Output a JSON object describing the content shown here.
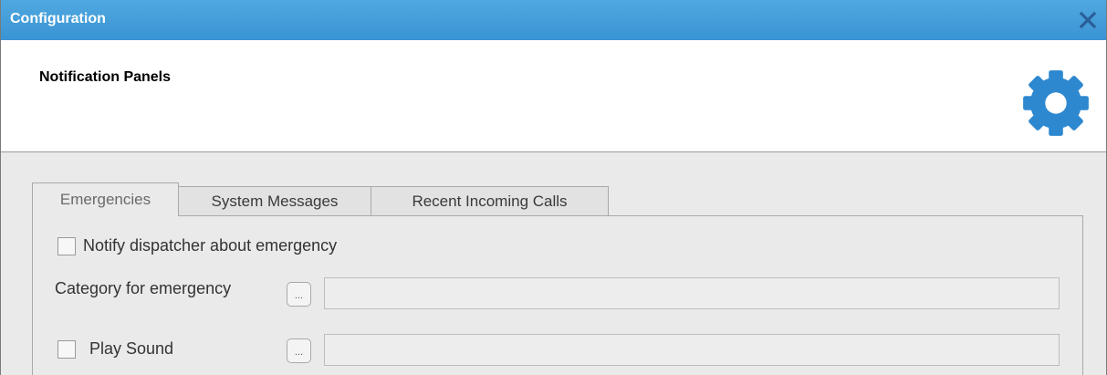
{
  "window": {
    "title": "Configuration",
    "close_icon": "close-icon",
    "accent_color": "#3b94d3"
  },
  "header": {
    "title": "Notification Panels",
    "icon": "gear-icon",
    "icon_color": "#2e88cf"
  },
  "tabs": [
    {
      "label": "Emergencies",
      "active": true
    },
    {
      "label": "System Messages",
      "active": false
    },
    {
      "label": "Recent Incoming Calls",
      "active": false
    }
  ],
  "emergencies": {
    "notify_checkbox": {
      "label": "Notify dispatcher about emergency",
      "checked": false
    },
    "category": {
      "label": "Category for emergency",
      "browse_label": "...",
      "value": ""
    },
    "play_sound": {
      "label": "Play Sound",
      "checked": false,
      "browse_label": "...",
      "value": ""
    }
  }
}
